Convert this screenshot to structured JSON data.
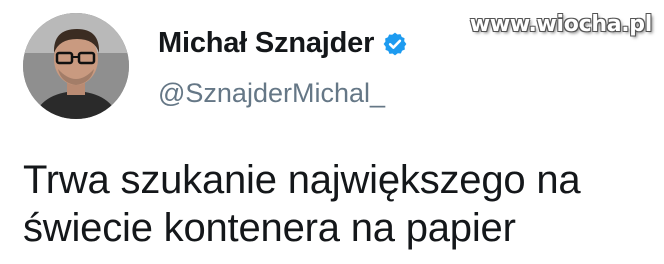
{
  "author": {
    "display_name": "Michał Sznajder",
    "handle": "@SznajderMichal_",
    "verified": true,
    "verified_color": "#1d9bf0",
    "avatar_icon": "person-avatar"
  },
  "tweet": {
    "line1": "Trwa szukanie największego na",
    "line2": "świecie kontenera na papier"
  },
  "watermark": {
    "text": "www.wiocha.pl"
  },
  "colors": {
    "text": "#14171a",
    "handle": "#657786",
    "background": "#ffffff"
  }
}
